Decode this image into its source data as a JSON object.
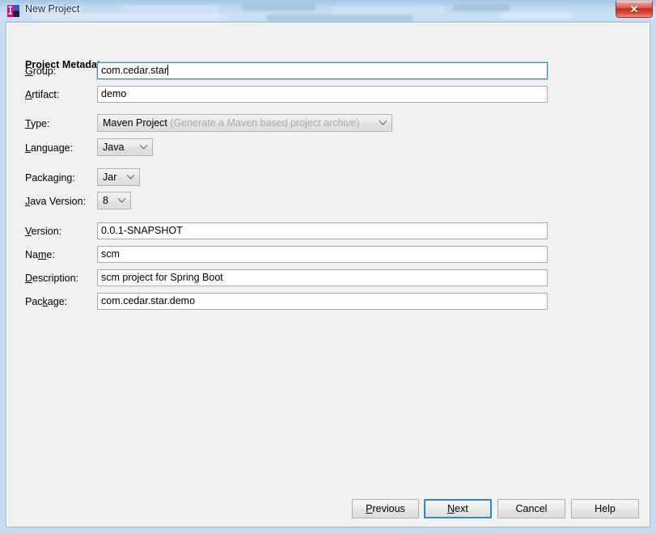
{
  "window": {
    "title": "New Project",
    "app_icon": "intellij-idea-icon",
    "close_label": "✕"
  },
  "dialog": {
    "section_title": "Project Metadata",
    "fields": [
      {
        "key": "group",
        "label": "Group:",
        "mnemonic": "G",
        "control": "text",
        "value": "com.cedar.star",
        "focused": true
      },
      {
        "key": "artifact",
        "label": "Artifact:",
        "mnemonic": "A",
        "control": "text",
        "value": "demo",
        "focused": false
      },
      {
        "key": "type",
        "label": "Type:",
        "mnemonic": "T",
        "control": "combo",
        "value": "Maven Project",
        "hint": "(Generate a Maven based project archive)"
      },
      {
        "key": "language",
        "label": "Language:",
        "mnemonic": "L",
        "control": "combo",
        "value": "Java"
      },
      {
        "key": "packaging",
        "label": "Packaging:",
        "mnemonic": "g",
        "control": "combo",
        "value": "Jar"
      },
      {
        "key": "java_version",
        "label": "Java Version:",
        "mnemonic": "J",
        "control": "combo",
        "value": "8"
      },
      {
        "key": "version",
        "label": "Version:",
        "mnemonic": "V",
        "control": "text",
        "value": "0.0.1-SNAPSHOT",
        "focused": false
      },
      {
        "key": "name",
        "label": "Name:",
        "mnemonic": "m",
        "control": "text",
        "value": "scm",
        "focused": false
      },
      {
        "key": "description",
        "label": "Description:",
        "mnemonic": "D",
        "control": "text",
        "value": "scm project for Spring Boot",
        "focused": false
      },
      {
        "key": "package",
        "label": "Package:",
        "mnemonic": "k",
        "control": "text",
        "value": "com.cedar.star.demo",
        "focused": false
      }
    ],
    "buttons": [
      {
        "key": "previous",
        "label": "Previous",
        "mnemonic": "P",
        "default": false
      },
      {
        "key": "next",
        "label": "Next",
        "mnemonic": "N",
        "default": true
      },
      {
        "key": "cancel",
        "label": "Cancel",
        "mnemonic": "",
        "default": false
      },
      {
        "key": "help",
        "label": "Help",
        "mnemonic": "",
        "default": false
      }
    ]
  },
  "labels": {
    "group_pre": "",
    "group_u": "G",
    "group_post": "roup:",
    "artifact_pre": "",
    "artifact_u": "A",
    "artifact_post": "rtifact:",
    "type_pre": "",
    "type_u": "T",
    "type_post": "ype:",
    "language_pre": "",
    "language_u": "L",
    "language_post": "anguage:",
    "packaging_pre": "Packa",
    "packaging_u": "g",
    "packaging_post": "ing:",
    "javaversion_pre": "",
    "javaversion_u": "J",
    "javaversion_post": "ava Version:",
    "version_pre": "",
    "version_u": "V",
    "version_post": "ersion:",
    "name_pre": "Na",
    "name_u": "m",
    "name_post": "e:",
    "description_pre": "",
    "description_u": "D",
    "description_post": "escription:",
    "package_pre": "Pac",
    "package_u": "k",
    "package_post": "age:",
    "previous_pre": "",
    "previous_u": "P",
    "previous_post": "revious",
    "next_pre": "",
    "next_u": "N",
    "next_post": "ext",
    "cancel": "Cancel",
    "help": "Help"
  },
  "colors": {
    "dialog_bg": "#f1f1ef",
    "focus_border": "#3f87a6",
    "default_button_border": "#2a8ad4",
    "hint_text": "#a9a9a9",
    "close_red": "#c72c20",
    "glass_blue": "#bdd7ee"
  }
}
